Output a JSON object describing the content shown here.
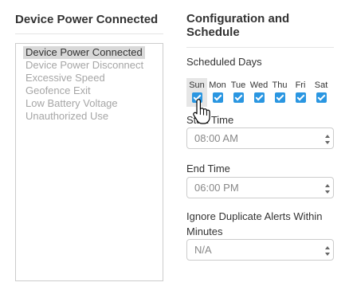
{
  "alert_types": {
    "title": "Device Power Connected",
    "options": [
      "Device Power Connected",
      "Device Power Disconnect",
      "Excessive Speed",
      "Geofence Exit",
      "Low Battery Voltage",
      "Unauthorized Use"
    ],
    "selected_index": 0
  },
  "configuration": {
    "title": "Configuration and Schedule",
    "scheduled_days": {
      "label": "Scheduled Days",
      "days": [
        {
          "name": "Sun",
          "checked": true
        },
        {
          "name": "Mon",
          "checked": true
        },
        {
          "name": "Tue",
          "checked": true
        },
        {
          "name": "Wed",
          "checked": true
        },
        {
          "name": "Thu",
          "checked": true
        },
        {
          "name": "Fri",
          "checked": true
        },
        {
          "name": "Sat",
          "checked": true
        }
      ]
    },
    "start_time": {
      "label": "Start Time",
      "value": "08:00 AM"
    },
    "end_time": {
      "label": "End Time",
      "value": "06:00 PM"
    },
    "ignore_duplicates": {
      "label": "Ignore Duplicate Alerts Within Minutes",
      "value": "N/A"
    }
  },
  "colors": {
    "checkbox": "#2a96e1",
    "selected_option_bg": "#d9d9d9",
    "disabled_text": "#a6a6a6"
  },
  "cursor_icon": "hand-pointer-icon"
}
